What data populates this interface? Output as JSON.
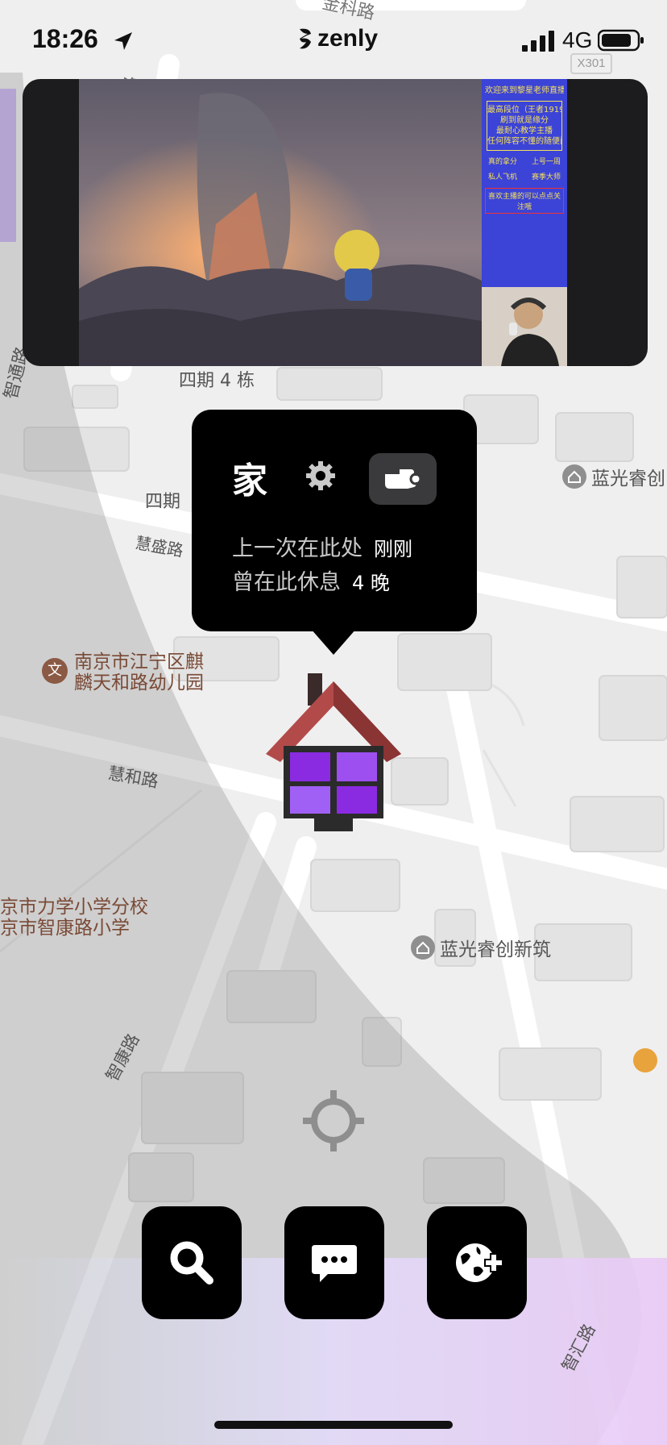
{
  "status_bar": {
    "time": "18:26",
    "network": "4G",
    "brand": "zenly",
    "plate": "X301"
  },
  "video": {
    "promo": {
      "welcome": "欢迎来到黎星老师直播间",
      "line1": "最高段位（王者1919分）",
      "line2": "刷到就是缘分",
      "line3": "最耐心教学主播",
      "line4": "任何阵容不懂的随便问",
      "item_a": "真的拿分",
      "item_b": "上号一周",
      "item_c": "私人飞机",
      "item_d": "赛季大师",
      "footer": "喜欢主播的可以点点关注哦"
    }
  },
  "map_labels": {
    "street_top": "金科路",
    "street_tong": "通路",
    "street_zhitong": "智通路",
    "building_4": "四期 4 栋",
    "building_4b": "四期",
    "huisheng": "慧盛路",
    "languang_top": "蓝光睿创",
    "kindergarten_line1": "南京市江宁区麒",
    "kindergarten_line2": "麟天和路幼儿园",
    "huihe": "慧和路",
    "school_line1": "京市力学小学分校",
    "school_line2": "京市智康路小学",
    "languang_bottom": "蓝光睿创新筑",
    "zhikang": "智康路",
    "zhihui": "智汇路"
  },
  "popup": {
    "title": "家",
    "last_here_label": "上一次在此处",
    "last_here_value": "刚刚",
    "rested_label": "曾在此休息",
    "rested_value": "4 晚"
  },
  "colors": {
    "accent_purple": "#8a2be2",
    "poi_brown": "#8a5a44",
    "poi_orange": "#e8a33c"
  }
}
